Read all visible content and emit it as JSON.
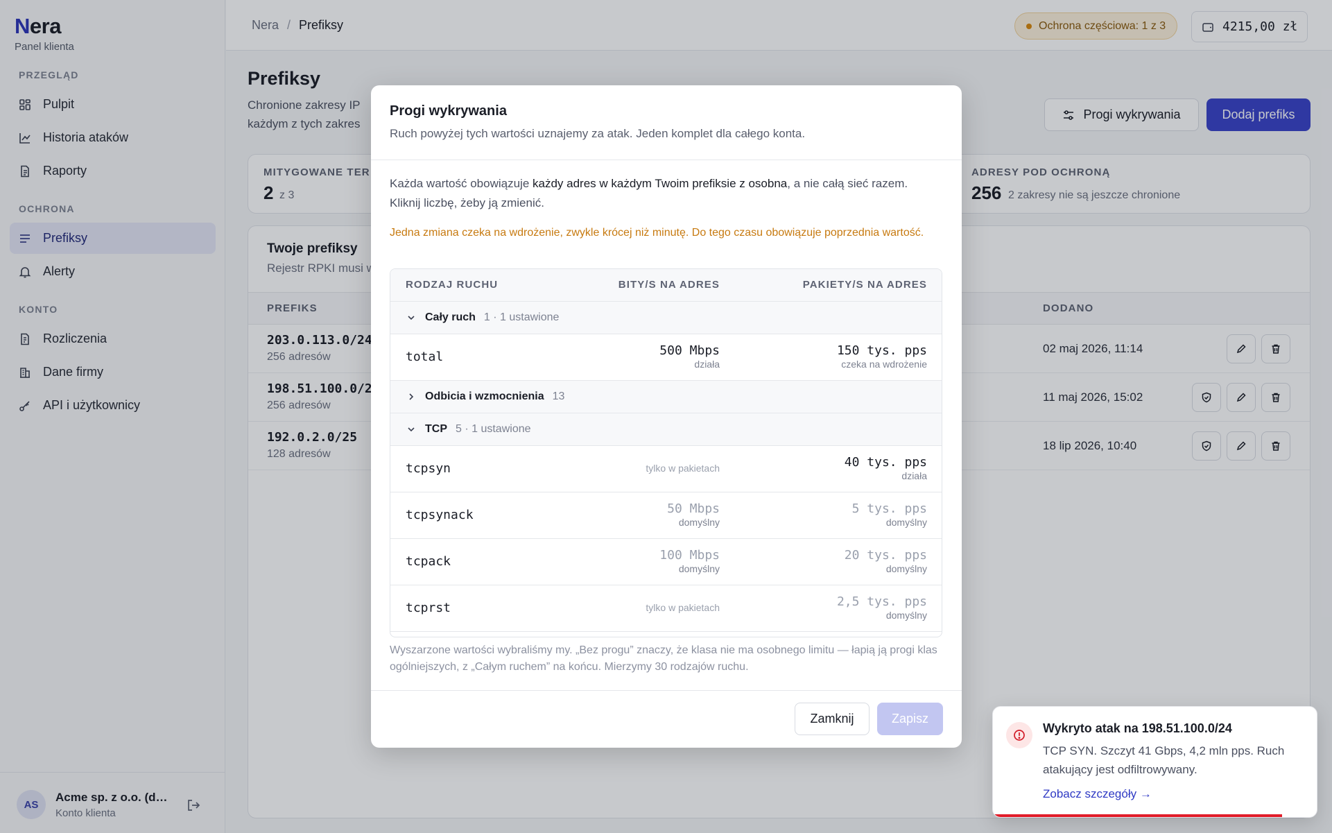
{
  "sidebar": {
    "brand": {
      "first": "N",
      "rest": "era",
      "sub": "Panel klienta"
    },
    "sections": [
      {
        "title": "PRZEGLĄD",
        "items": [
          {
            "label": "Pulpit",
            "icon": "dashboard-icon"
          },
          {
            "label": "Historia ataków",
            "icon": "chart-line-icon"
          },
          {
            "label": "Raporty",
            "icon": "document-icon"
          }
        ]
      },
      {
        "title": "OCHRONA",
        "items": [
          {
            "label": "Prefiksy",
            "icon": "list-icon",
            "active": true
          },
          {
            "label": "Alerty",
            "icon": "bell-icon"
          }
        ]
      },
      {
        "title": "KONTO",
        "items": [
          {
            "label": "Rozliczenia",
            "icon": "invoice-icon"
          },
          {
            "label": "Dane firmy",
            "icon": "building-icon"
          },
          {
            "label": "API i użytkownicy",
            "icon": "key-icon"
          }
        ]
      }
    ],
    "account": {
      "initials": "AS",
      "name": "Acme sp. z o.o. (demo)",
      "role": "Konto klienta"
    }
  },
  "topbar": {
    "breadcrumb": [
      "Nera",
      "Prefiksy"
    ],
    "protection_badge": "Ochrona częściowa: 1 z 3",
    "balance": "4215,00 zł"
  },
  "page": {
    "title": "Prefiksy",
    "description_line1": "Chronione zakresy IP",
    "description_line2": "każdym z tych zakres",
    "buttons": {
      "thresholds": "Progi wykrywania",
      "add": "Dodaj prefiks"
    },
    "stats": [
      {
        "label": "MITYGOWANE TER",
        "value": "2",
        "sub": "z 3"
      },
      {
        "label": "ADRESY POD OCHRONĄ",
        "value": "256",
        "sub": "2 zakresy nie są jeszcze chronione"
      }
    ],
    "card": {
      "title": "Twoje prefiksy",
      "subtitle": "Rejestr RPKI musi w",
      "columns": {
        "prefix": "PREFIKS",
        "added": "DODANO"
      },
      "rows": [
        {
          "prefix": "203.0.113.0/24",
          "addresses": "256 adresów",
          "added": "02 maj 2026, 11:14"
        },
        {
          "prefix": "198.51.100.0/24",
          "addresses": "256 adresów",
          "added": "11 maj 2026, 15:02"
        },
        {
          "prefix": "192.0.2.0/25",
          "addresses": "128 adresów",
          "added": "18 lip 2026, 10:40"
        }
      ]
    }
  },
  "modal": {
    "title": "Progi wykrywania",
    "subtitle": "Ruch powyżej tych wartości uznajemy za atak. Jeden komplet dla całego konta.",
    "info_before": "Każda wartość obowiązuje ",
    "info_bold": "każdy adres w każdym Twoim prefiksie z osobna",
    "info_after": ", a nie całą sieć razem. Kliknij liczbę, żeby ją zmienić.",
    "warning": "Jedna zmiana czeka na wdrożenie, zwykle krócej niż minutę. Do tego czasu obowiązuje poprzednia wartość.",
    "table": {
      "columns": {
        "type": "RODZAJ RUCHU",
        "bits": "BITY/S NA ADRES",
        "packets": "PAKIETY/S NA ADRES"
      },
      "groups": [
        {
          "name": "Cały ruch",
          "count": "1 · 1 ustawione",
          "expanded": true
        },
        {
          "name": "Odbicia i wzmocnienia",
          "count": "13",
          "expanded": false
        },
        {
          "name": "TCP",
          "count": "5 · 1 ustawione",
          "expanded": true
        }
      ],
      "rows": [
        {
          "name": "total",
          "bits": "500 Mbps",
          "bits_status": "działa",
          "pps": "150 tys. pps",
          "pps_status": "czeka na wdrożenie"
        },
        {
          "name": "tcpsyn",
          "bits_note": "tylko w pakietach",
          "pps": "40 tys. pps",
          "pps_status": "działa"
        },
        {
          "name": "tcpsynack",
          "bits": "50 Mbps",
          "bits_status": "domyślny",
          "pps": "5 tys. pps",
          "pps_status": "domyślny"
        },
        {
          "name": "tcpack",
          "bits": "100 Mbps",
          "bits_status": "domyślny",
          "pps": "20 tys. pps",
          "pps_status": "domyślny"
        },
        {
          "name": "tcprst",
          "bits_note": "tylko w pakietach",
          "pps": "2,5 tys. pps",
          "pps_status": "domyślny"
        }
      ]
    },
    "footnote": "Wyszarzone wartości wybraliśmy my. „Bez progu” znaczy, że klasa nie ma osobnego limitu — łapią ją progi klas ogólniejszych, z „Całym ruchem” na końcu. Mierzymy 30 rodzajów ruchu.",
    "buttons": {
      "close": "Zamknij",
      "save": "Zapisz"
    }
  },
  "toast": {
    "title": "Wykryto atak na 198.51.100.0/24",
    "body": "TCP SYN. Szczyt 41 Gbps, 4,2 mln pps. Ruch atakujący jest odfiltrowywany.",
    "link": "Zobacz szczegóły",
    "remaining": 0.89
  },
  "colors": {
    "accent": "#3a43c9",
    "warning": "#c77a10",
    "danger": "#e11d2a"
  }
}
